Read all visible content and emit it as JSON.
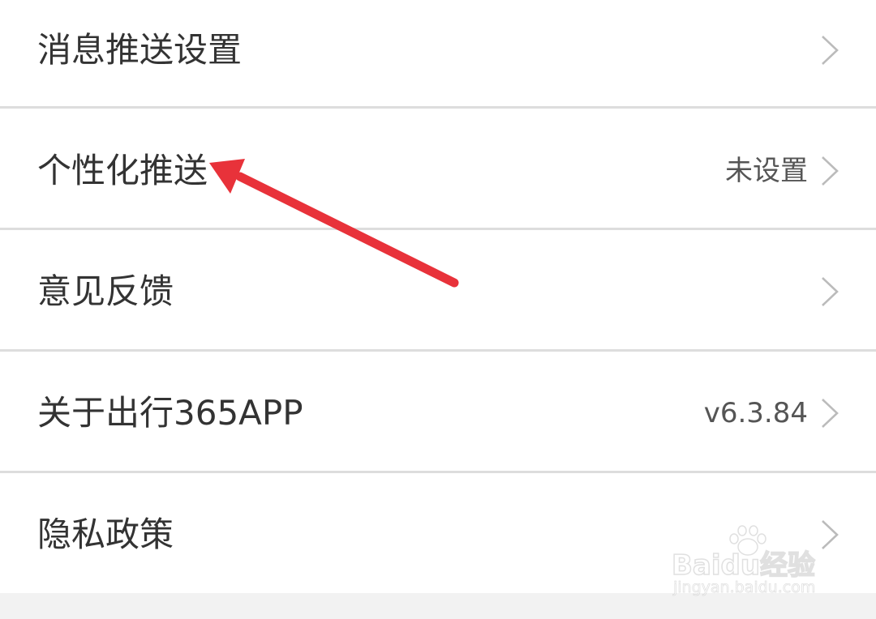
{
  "settings": {
    "items": [
      {
        "label": "消息推送设置",
        "value": ""
      },
      {
        "label": "个性化推送",
        "value": "未设置"
      },
      {
        "label": "意见反馈",
        "value": ""
      },
      {
        "label": "关于出行365APP",
        "value": "v6.3.84"
      },
      {
        "label": "隐私政策",
        "value": ""
      }
    ]
  },
  "watermark": {
    "brand": "Baidu经验",
    "url": "jingyan.baidu.com"
  },
  "colors": {
    "annotation_arrow": "#e8323a",
    "label_text": "#333333",
    "value_text": "#555555",
    "divider": "#dddddd",
    "chevron": "#bbbbbb"
  },
  "icons": {
    "row_chevron": "chevron-right-icon",
    "annotation": "red-arrow-icon"
  }
}
